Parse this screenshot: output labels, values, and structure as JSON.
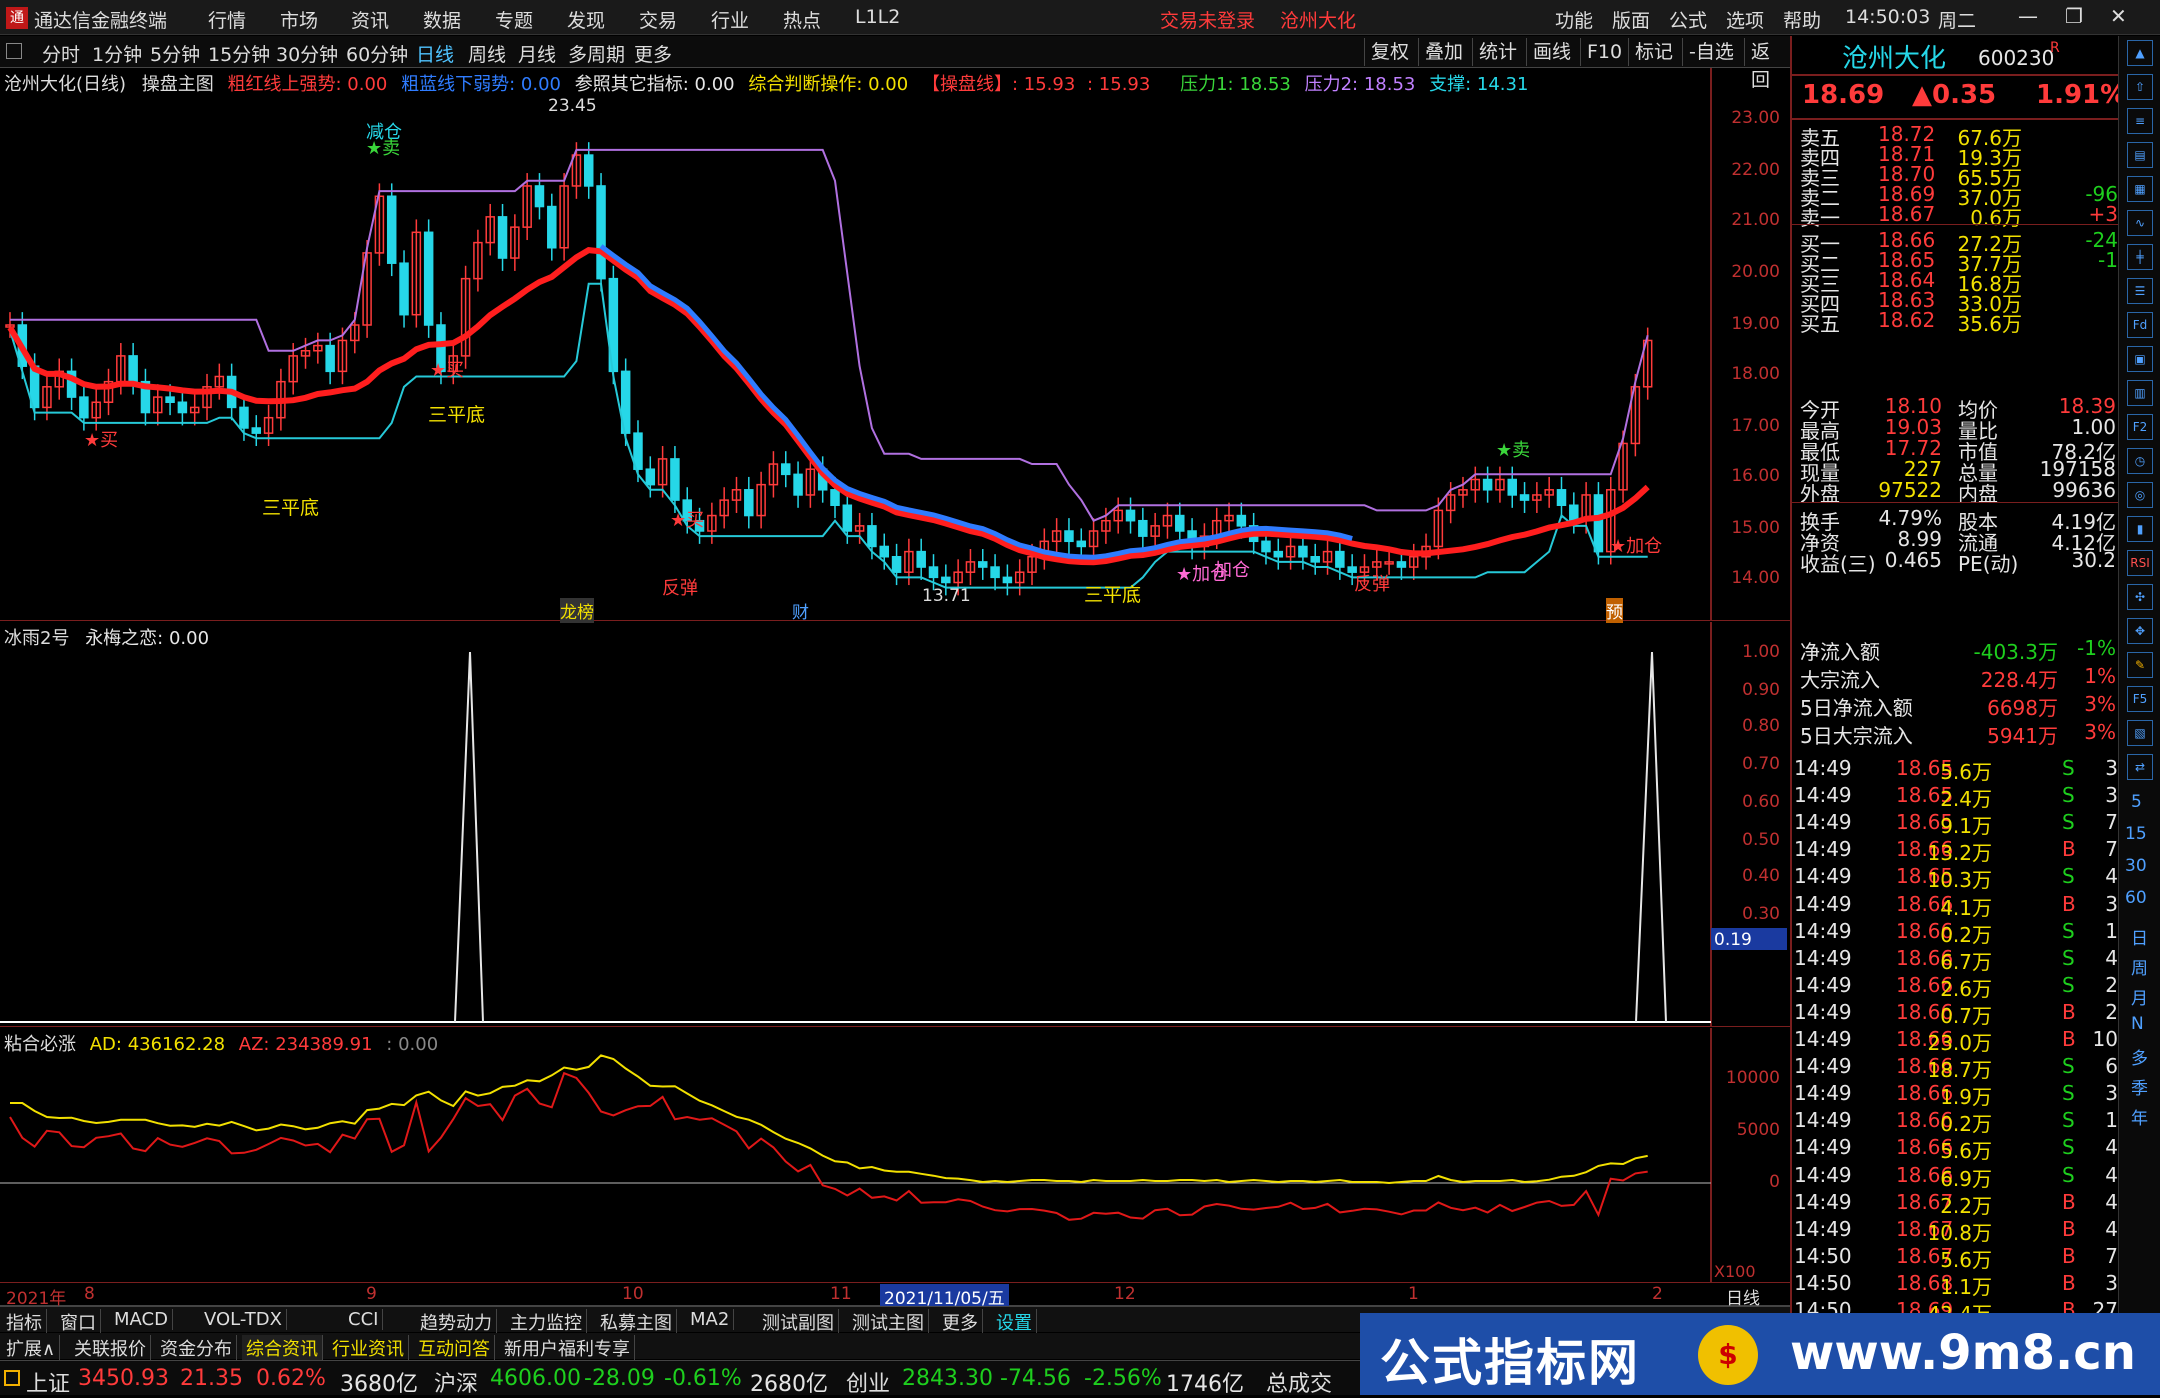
{
  "top": {
    "app_title": "通达信金融终端",
    "menus": [
      "行情",
      "市场",
      "资讯",
      "数据",
      "专题",
      "发现",
      "交易",
      "行业",
      "热点",
      "L1L2"
    ],
    "warn1": "交易未登录",
    "warn2": "沧州大化",
    "right_menus": [
      "功能",
      "版面",
      "公式",
      "选项",
      "帮助"
    ],
    "time": "14:50:03",
    "weekday": "周二"
  },
  "periods": [
    "分时",
    "1分钟",
    "5分钟",
    "15分钟",
    "30分钟",
    "60分钟",
    "日线",
    "周线",
    "月线",
    "多周期",
    "更多"
  ],
  "tools": [
    "复权",
    "叠加",
    "统计",
    "画线",
    "F10",
    "标记",
    "-自选",
    "返回"
  ],
  "main": {
    "title": "沧州大化(日线)",
    "formula": "操盘主图",
    "i1": "粗红线上强势: 0.00",
    "i2": "粗蓝线下弱势: 0.00",
    "i3": "参照其它指标: 0.00",
    "i4": "综合判断操作: 0.00",
    "i5": "【操盘线】: 15.93",
    "i6": ": 15.93",
    "i7": "压力1: 18.53",
    "i8": "压力2: 18.53",
    "i9": "支撑: 14.31",
    "yticks": [
      "23.00",
      "22.00",
      "21.00",
      "20.00",
      "19.00",
      "18.00",
      "17.00",
      "16.00",
      "15.00",
      "14.00"
    ],
    "labels": {
      "high": "23.45",
      "low": "13.71",
      "sell1": "减仓",
      "sell2": "★卖",
      "buy1": "★买",
      "buy2": "★买",
      "buy3": "★买",
      "sb1": "三平底",
      "sb2": "三平底",
      "sb3": "三平底",
      "add1": "★加仓",
      "add2": "加仓",
      "add3": "★加仓",
      "sell3": "★卖",
      "fd1": "反弹",
      "fd2": "反弹",
      "m1": "龙榜",
      "m2": "财",
      "m3": "预"
    }
  },
  "ind1": {
    "name": "冰雨2号",
    "t1": "永梅之恋: 0.00",
    "yticks": [
      "1.00",
      "0.90",
      "0.80",
      "0.70",
      "0.60",
      "0.50",
      "0.40",
      "0.30"
    ],
    "cur": "0.19"
  },
  "ind2": {
    "name": "粘合必涨",
    "ad": "AD: 436162.28",
    "az": "AZ: 234389.91",
    "z": ": 0.00",
    "yticks": [
      "10000",
      "5000",
      "0"
    ],
    "x100": "X100"
  },
  "xaxis": {
    "year": "2021年",
    "m8": "8",
    "m9": "9",
    "m10": "10",
    "m11": "11",
    "date": "2021/11/05/五",
    "m12": "12",
    "m1": "1",
    "m2": "2",
    "period": "日线"
  },
  "quote": {
    "name": "沧州大化",
    "code": "600230",
    "r": "R",
    "price": "18.69",
    "chg": "▲0.35",
    "pct": "1.91%",
    "asks": [
      [
        "卖五",
        "18.72",
        "67.6万",
        ""
      ],
      [
        "卖四",
        "18.71",
        "19.3万",
        ""
      ],
      [
        "卖三",
        "18.70",
        "65.5万",
        ""
      ],
      [
        "卖二",
        "18.69",
        "37.0万",
        "-96"
      ],
      [
        "卖一",
        "18.67",
        "0.6万",
        "+3"
      ]
    ],
    "bids": [
      [
        "买一",
        "18.66",
        "27.2万",
        "-24"
      ],
      [
        "买二",
        "18.65",
        "37.7万",
        "-1"
      ],
      [
        "买三",
        "18.64",
        "16.8万",
        ""
      ],
      [
        "买四",
        "18.63",
        "33.0万",
        ""
      ],
      [
        "买五",
        "18.62",
        "35.6万",
        ""
      ]
    ],
    "s1": [
      [
        "今开",
        "18.10",
        "均价",
        "18.39"
      ],
      [
        "最高",
        "19.03",
        "量比",
        "1.00"
      ],
      [
        "最低",
        "17.72",
        "市值",
        "78.2亿"
      ],
      [
        "现量",
        "227",
        "总量",
        "197158"
      ],
      [
        "外盘",
        "97522",
        "内盘",
        "99636"
      ]
    ],
    "s2": [
      [
        "换手",
        "4.79%",
        "股本",
        "4.19亿"
      ],
      [
        "净资",
        "8.99",
        "流通",
        "4.12亿"
      ],
      [
        "收益(三)",
        "0.465",
        "PE(动)",
        "30.2"
      ]
    ],
    "flows": [
      [
        "净流入额",
        "-403.3万",
        "-1%"
      ],
      [
        "大宗流入",
        "228.4万",
        "1%"
      ],
      [
        "5日净流入额",
        "6698万",
        "3%"
      ],
      [
        "5日大宗流入",
        "5941万",
        "3%"
      ]
    ],
    "ticks": [
      [
        "14:49",
        "18.65",
        "5.6万",
        "S",
        "3"
      ],
      [
        "14:49",
        "18.65",
        "2.4万",
        "S",
        "3"
      ],
      [
        "14:49",
        "18.65",
        "9.1万",
        "S",
        "7"
      ],
      [
        "14:49",
        "18.66",
        "13.2万",
        "B",
        "7"
      ],
      [
        "14:49",
        "18.65",
        "10.3万",
        "S",
        "4"
      ],
      [
        "14:49",
        "18.66",
        "4.1万",
        "B",
        "3"
      ],
      [
        "14:49",
        "18.66",
        "0.2万",
        "S",
        "1"
      ],
      [
        "14:49",
        "18.66",
        "6.7万",
        "S",
        "4"
      ],
      [
        "14:49",
        "18.66",
        "2.6万",
        "S",
        "2"
      ],
      [
        "14:49",
        "18.66",
        "0.7万",
        "B",
        "2"
      ],
      [
        "14:49",
        "18.66",
        "23.0万",
        "B",
        "10"
      ],
      [
        "14:49",
        "18.66",
        "18.7万",
        "S",
        "6"
      ],
      [
        "14:49",
        "18.66",
        "1.9万",
        "S",
        "3"
      ],
      [
        "14:49",
        "18.66",
        "0.2万",
        "S",
        "1"
      ],
      [
        "14:49",
        "18.66",
        "5.6万",
        "S",
        "4"
      ],
      [
        "14:49",
        "18.66",
        "6.9万",
        "S",
        "4"
      ],
      [
        "14:49",
        "18.67",
        "2.2万",
        "B",
        "4"
      ],
      [
        "14:49",
        "18.67",
        "10.8万",
        "B",
        "4"
      ],
      [
        "14:50",
        "18.67",
        "5.6万",
        "B",
        "7"
      ],
      [
        "14:50",
        "18.68",
        "1.1万",
        "B",
        "3"
      ],
      [
        "14:50",
        "18.69",
        "42.4万",
        "B",
        "27"
      ]
    ]
  },
  "side": [
    "日",
    "周",
    "月",
    "N",
    "多",
    "季",
    "年"
  ],
  "side_nums": [
    "5",
    "15",
    "30",
    "60"
  ],
  "tabs": [
    "指标",
    "窗口",
    "MACD",
    "VOL-TDX",
    "CCI",
    "趋势动力",
    "主力监控",
    "私募主图",
    "MA2",
    "测试副图",
    "测试主图",
    "更多",
    "设置"
  ],
  "tabs2": [
    "扩展∧",
    "关联报价",
    "资金分布",
    "综合资讯",
    "行业资讯",
    "互动问答",
    "新用户福利专享"
  ],
  "status": {
    "sh": "上证",
    "sh_v": "3450.93",
    "sh_c": "21.35",
    "sh_p": "0.62%",
    "sh_a": "3680亿",
    "sz": "沪深",
    "sz_v": "4606.00",
    "sz_c": "-28.09",
    "sz_p": "-0.61%",
    "sz_a": "2680亿",
    "cy": "创业",
    "cy_v": "2843.30",
    "cy_c": "-74.56",
    "cy_p": "-2.56%",
    "cy_a": "1746亿",
    "tot": "总成交"
  },
  "ad": {
    "t1": "公式指标网",
    "t2": "www.9m8.cn"
  },
  "colors": {
    "up": "#ff3b3b",
    "down": "#26d7e8",
    "red_line": "#ff1e1e",
    "blue_line": "#2f7cff"
  }
}
